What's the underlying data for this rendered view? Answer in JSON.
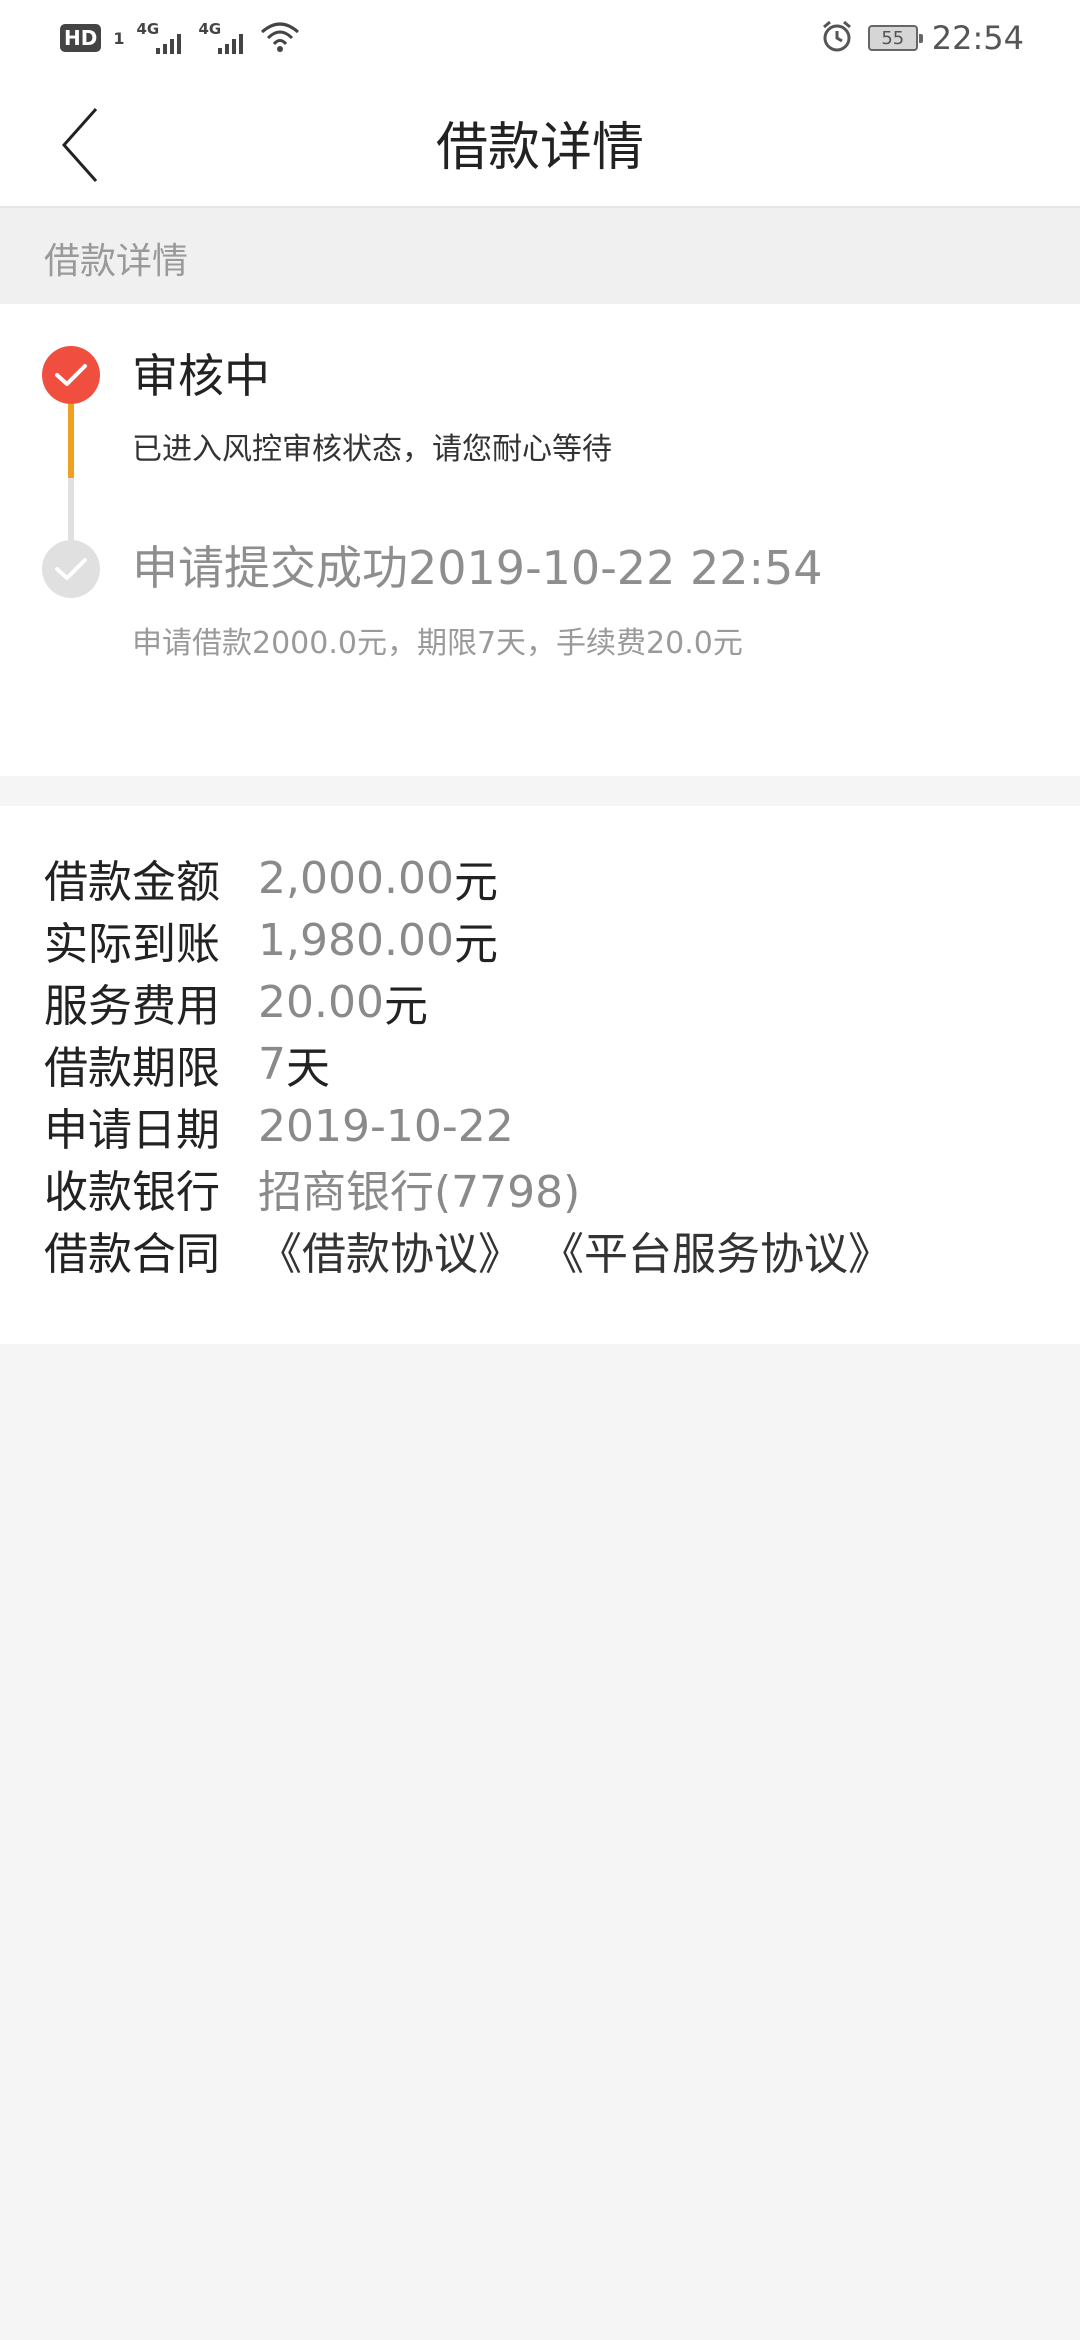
{
  "status_bar": {
    "hd_label": "HD",
    "sim_slot": "1",
    "network_1": "4G",
    "network_2": "4G",
    "battery": "55",
    "time": "22:54"
  },
  "nav": {
    "title": "借款详情"
  },
  "section_header": "借款详情",
  "progress": {
    "step_active": {
      "title": "审核中",
      "description": "已进入风控审核状态，请您耐心等待"
    },
    "step_done": {
      "title": "申请提交成功2019-10-22 22:54",
      "description": "申请借款2000.0元，期限7天，手续费20.0元"
    }
  },
  "details": {
    "loan_amount": {
      "label": "借款金额",
      "value": "2,000.00",
      "unit": "元"
    },
    "actual_received": {
      "label": "实际到账",
      "value": "1,980.00",
      "unit": "元"
    },
    "service_fee": {
      "label": "服务费用",
      "value": "20.00",
      "unit": "元"
    },
    "loan_term": {
      "label": "借款期限",
      "value": "7",
      "unit": "天"
    },
    "apply_date": {
      "label": "申请日期",
      "value": "2019-10-22"
    },
    "receiving_bank": {
      "label": "收款银行",
      "value": "招商银行(7798)"
    },
    "contract": {
      "label": "借款合同",
      "links": [
        "《借款协议》",
        "《平台服务协议》"
      ]
    }
  },
  "colors": {
    "accent_red": "#f04f3f",
    "progress_orange": "#f0a020",
    "inactive_gray": "#e0e0e0"
  }
}
